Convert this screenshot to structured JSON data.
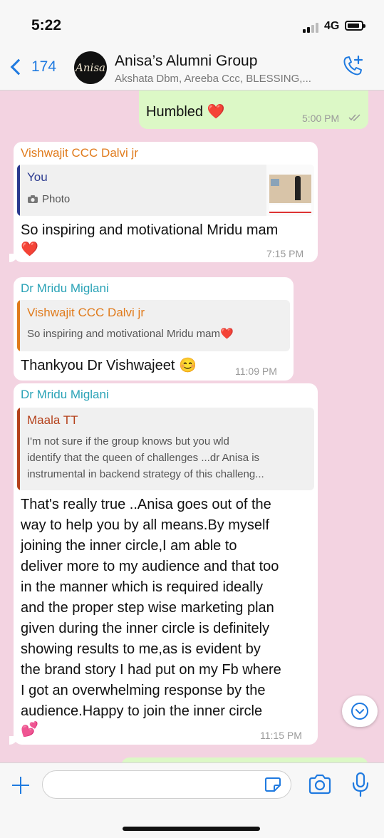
{
  "status_bar": {
    "time": "5:22",
    "network": "4G"
  },
  "header": {
    "back_count": "174",
    "avatar_text": "Anisa",
    "title": "Anisa’s Alumni Group",
    "members": "Akshata Dbm, Areeba Ccc, BLESSING,..."
  },
  "messages": [
    {
      "type": "outgoing",
      "text": "Humbled ❤️",
      "time": "5:00 PM"
    },
    {
      "type": "incoming",
      "sender": "Vishwajit CCC Dalvi jr",
      "sender_color": "#e07b1c",
      "reply": {
        "author": "You",
        "text": "Photo",
        "bar_color": "#2b3a8f"
      },
      "text_line1": "So inspiring and motivational Mridu mam",
      "text_line2": "❤️",
      "time": "7:15 PM"
    },
    {
      "type": "incoming",
      "sender": "Dr Mridu Miglani",
      "sender_color": "#2aa3b7",
      "reply": {
        "author": "Vishwajit CCC Dalvi jr",
        "text": "So inspiring and motivational Mridu mam❤️",
        "bar_color": "#e07b1c"
      },
      "text": "Thankyou Dr Vishwajeet 😊",
      "time": "11:09 PM"
    },
    {
      "type": "incoming",
      "sender": "Dr Mridu Miglani",
      "sender_color": "#2aa3b7",
      "reply": {
        "author": "Maala TT",
        "bar_color": "#b5421c",
        "lines": [
          "I'm not sure if the group knows but you wld",
          "identify that the queen of challenges ...dr Anisa is",
          "instrumental in backend strategy of this challeng..."
        ]
      },
      "lines": [
        "That's really true ..Anisa goes out of the",
        "way to help you by all means.By myself",
        "joining the inner circle,I am able to",
        "deliver more to my audience and that too",
        "in the manner which is required ideally",
        "and the proper step wise marketing plan",
        "given during the inner circle is definitely",
        "showing results to me,as is evident by",
        "the brand story I had put on my Fb where",
        "I got an overwhelming response by the",
        "audience.Happy to join the inner circle",
        "💕"
      ],
      "time": "11:15 PM"
    }
  ],
  "input": {
    "placeholder": ""
  },
  "colors": {
    "accent": "#1f7ae0",
    "background": "#f3d3e1",
    "outgoing": "#dcf8c6"
  }
}
